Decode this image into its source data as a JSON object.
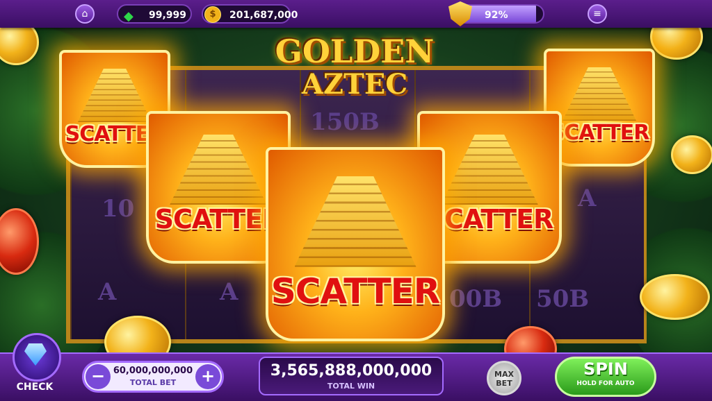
{
  "topbar": {
    "home_icon": "home-icon",
    "gems": "99,999",
    "coins": "201,687,000",
    "shield_percent": "92%",
    "menu_icon": "menu-icon"
  },
  "logo": {
    "line1": "GOLDEN",
    "line2": "AZTEC"
  },
  "reels": {
    "background_symbols": [
      "150B",
      "10",
      "A",
      "00B",
      "50B",
      "A",
      "A"
    ]
  },
  "scatter_label": "SCATTER",
  "bottombar": {
    "check_label": "CHECK",
    "total_bet_value": "60,000,000,000",
    "total_bet_label": "TOTAL BET",
    "minus": "−",
    "plus": "+",
    "total_win_value": "3,565,888,000,000",
    "total_win_label": "TOTAL WIN",
    "max_bet_line1": "MAX",
    "max_bet_line2": "BET",
    "spin_label": "SPIN",
    "spin_sublabel": "HOLD FOR AUTO"
  },
  "progress": {
    "shield_fill": 0.92
  },
  "colors": {
    "accent": "#6a2aa8",
    "spin_green": "#3fbf2a",
    "scatter_red": "#e01010",
    "gold": "#ffd23a"
  }
}
